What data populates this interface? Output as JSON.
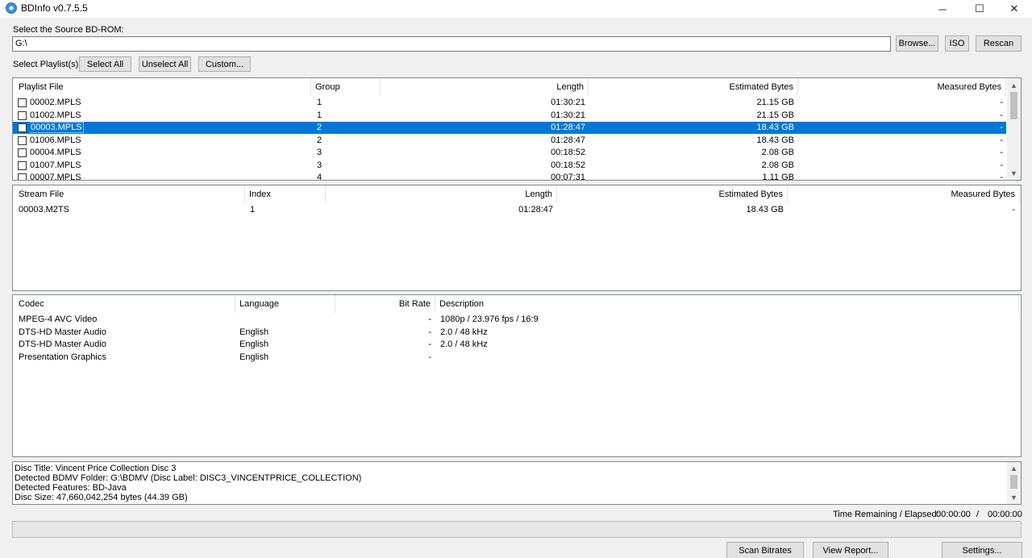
{
  "window": {
    "title": "BDInfo v0.7.5.5",
    "minimize": "─",
    "maximize": "☐",
    "close": "✕"
  },
  "source": {
    "label": "Select the Source BD-ROM:",
    "path": "G:\\",
    "browse": "Browse...",
    "iso": "ISO",
    "rescan": "Rescan"
  },
  "playlist_select": {
    "label": "Select Playlist(s):",
    "select_all": "Select All",
    "unselect_all": "Unselect All",
    "custom": "Custom..."
  },
  "playlists": {
    "headers": [
      "Playlist File",
      "Group",
      "Length",
      "Estimated Bytes",
      "Measured Bytes"
    ],
    "rows": [
      {
        "file": "00002.MPLS",
        "group": "1",
        "length": "01:30:21",
        "est": "21.15 GB",
        "meas": "-",
        "selected": false
      },
      {
        "file": "01002.MPLS",
        "group": "1",
        "length": "01:30:21",
        "est": "21.15 GB",
        "meas": "-",
        "selected": false
      },
      {
        "file": "00003.MPLS",
        "group": "2",
        "length": "01:28:47",
        "est": "18.43 GB",
        "meas": "-",
        "selected": true
      },
      {
        "file": "01006.MPLS",
        "group": "2",
        "length": "01:28:47",
        "est": "18.43 GB",
        "meas": "-",
        "selected": false
      },
      {
        "file": "00004.MPLS",
        "group": "3",
        "length": "00:18:52",
        "est": "2.08 GB",
        "meas": "-",
        "selected": false
      },
      {
        "file": "01007.MPLS",
        "group": "3",
        "length": "00:18:52",
        "est": "2.08 GB",
        "meas": "-",
        "selected": false
      },
      {
        "file": "00007.MPLS",
        "group": "4",
        "length": "00:07:31",
        "est": "1.11 GB",
        "meas": "-",
        "selected": false
      }
    ]
  },
  "streams": {
    "headers": [
      "Stream File",
      "Index",
      "Length",
      "Estimated Bytes",
      "Measured Bytes"
    ],
    "rows": [
      {
        "file": "00003.M2TS",
        "index": "1",
        "length": "01:28:47",
        "est": "18.43 GB",
        "meas": "-"
      }
    ]
  },
  "codecs": {
    "headers": [
      "Codec",
      "Language",
      "Bit Rate",
      "Description"
    ],
    "rows": [
      {
        "codec": "MPEG-4 AVC Video",
        "language": "",
        "bitrate": "-",
        "desc": "1080p / 23.976 fps / 16:9"
      },
      {
        "codec": "DTS-HD Master Audio",
        "language": "English",
        "bitrate": "-",
        "desc": "2.0 / 48 kHz"
      },
      {
        "codec": "DTS-HD Master Audio",
        "language": "English",
        "bitrate": "-",
        "desc": "2.0 / 48 kHz"
      },
      {
        "codec": "Presentation Graphics",
        "language": "English",
        "bitrate": "-",
        "desc": ""
      }
    ]
  },
  "disc_info": [
    "Disc Title: Vincent Price Collection Disc 3",
    "Detected BDMV Folder: G:\\BDMV (Disc Label: DISC3_VINCENTPRICE_COLLECTION)",
    "Detected Features: BD-Java",
    "Disc Size: 47,660,042,254 bytes (44.39 GB)"
  ],
  "status": {
    "time_label": "Time Remaining / Elapsed:",
    "remaining": "00:00:00",
    "separator": "/",
    "elapsed": "00:00:00",
    "progress": 0
  },
  "footer": {
    "scan": "Scan Bitrates",
    "report": "View Report...",
    "settings": "Settings..."
  },
  "icons": {
    "app": "bdinfo-disc-icon",
    "scroll_up": "▲",
    "scroll_down": "▼"
  }
}
